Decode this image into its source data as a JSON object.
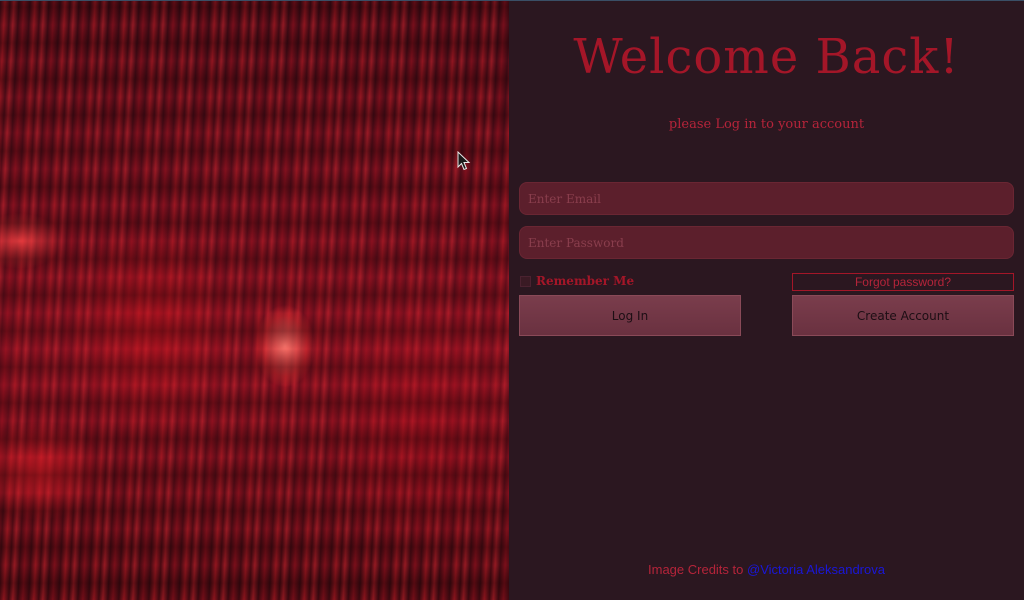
{
  "header": {
    "title": "Welcome Back!",
    "subtitle": "please Log in to your account"
  },
  "form": {
    "email_placeholder": "Enter Email",
    "email_value": "",
    "password_placeholder": "Enter Password",
    "password_value": "",
    "remember_label": "Remember Me",
    "remember_checked": false,
    "forgot_label": "Forgot password?",
    "login_label": "Log In",
    "create_label": "Create Account"
  },
  "footer": {
    "credits_prefix": "Image Credits to",
    "credits_link": "@Victoria Aleksandrova"
  },
  "hero": {
    "icon": "abstract-red-blur-image"
  },
  "colors": {
    "background": "#2b1720",
    "accent": "#a41628",
    "input_bg": "#5c1f2c",
    "button_bg": "#7a3d4c",
    "link": "#1a17d8"
  }
}
